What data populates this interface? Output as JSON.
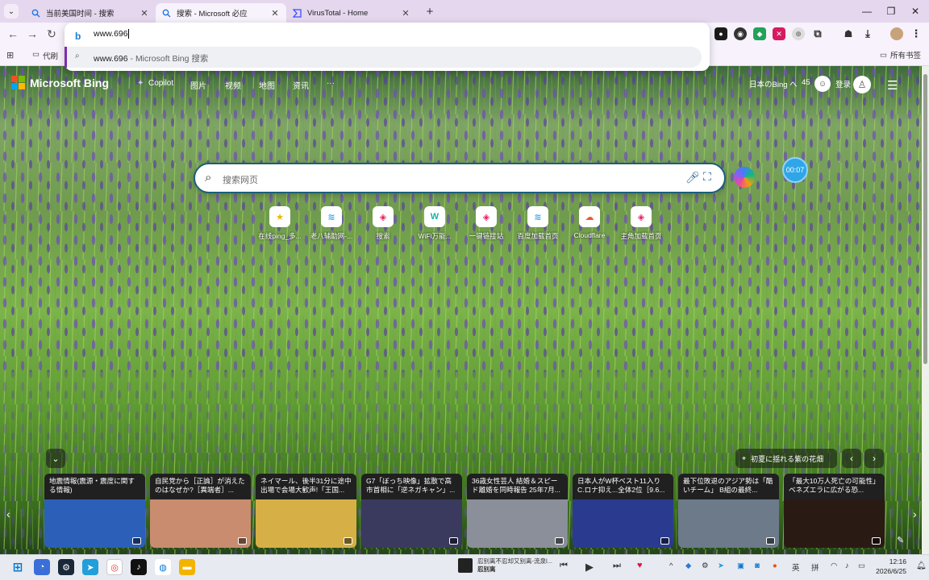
{
  "browser": {
    "tabs": [
      {
        "title": "当前美国时间 - 搜索",
        "active": false,
        "icon": "search-icon"
      },
      {
        "title": "搜索 - Microsoft 必应",
        "active": true,
        "icon": "search-icon"
      },
      {
        "title": "VirusTotal - Home",
        "active": false,
        "icon": "virustotal-icon"
      }
    ],
    "omnibox": {
      "value": "www.696",
      "suggestion_main": "www.696",
      "suggestion_sub": " - Microsoft Bing 搜索"
    },
    "bookmarks": {
      "folder_label": "代刷",
      "all_label": "所有书签"
    }
  },
  "bing": {
    "logo_text": "Microsoft Bing",
    "nav": [
      "Copilot",
      "图片",
      "视频",
      "地图",
      "资讯",
      "···"
    ],
    "region_label": "日本のBing へ",
    "points": "45",
    "login_label": "登录",
    "search_placeholder": "搜索网页",
    "timer": "00:07",
    "quicklinks": [
      {
        "label": "在线ping_多...",
        "color": "#f5c400",
        "glyph": "★"
      },
      {
        "label": "老八辅助网-...",
        "color": "#40a9e6",
        "glyph": "≋"
      },
      {
        "label": "搜索",
        "color": "#e91e63",
        "glyph": "◈"
      },
      {
        "label": "WiFi万能...",
        "color": "#16b4a9",
        "glyph": "W"
      },
      {
        "label": "一键链接站",
        "color": "#e91e63",
        "glyph": "◈"
      },
      {
        "label": "百度加载首页",
        "color": "#40a9e6",
        "glyph": "≋"
      },
      {
        "label": "Cloudflare",
        "color": "#f2542d",
        "glyph": "☁"
      },
      {
        "label": "主角加载首页",
        "color": "#e91e63",
        "glyph": "◈"
      }
    ],
    "image_caption": "初夏に揺れる紫の花畑",
    "news": [
      {
        "title": "地震情報(震源・震度に関する情報)",
        "img": "#2b5fb8"
      },
      {
        "title": "自民党から［正論］が消えたのはなぜか?［異端者］...",
        "img": "#c98c6e"
      },
      {
        "title": "ネイマール、後半31分に途中出場で会場大歓声!「王国...",
        "img": "#d6b046"
      },
      {
        "title": "G7「ぼっち映像」拡散で高市首相に「逆ネガキャン」...",
        "img": "#3a3a5e"
      },
      {
        "title": "36歳女性芸人 結婚＆スピード離婚を同時報告 25年7月...",
        "img": "#8a8f9a"
      },
      {
        "title": "日本人がW杯ベスト11入り C.ロナ抑え...全体2位［9.6...",
        "img": "#2a3b8f"
      },
      {
        "title": "最下位敗退のアジア勢は「酷いチーム」 B組の最終...",
        "img": "#6c7a8a"
      },
      {
        "title": "「最大10万人死亡の可能性」ベネズエラに広がる恐...",
        "img": "#2a1a14"
      }
    ]
  },
  "taskbar": {
    "media_title": "忍别离不忍却又别离-流泉l...",
    "media_artist": "忍别离",
    "ime1": "英",
    "ime2": "拼",
    "time": "12:16",
    "date": "2026/6/25"
  }
}
